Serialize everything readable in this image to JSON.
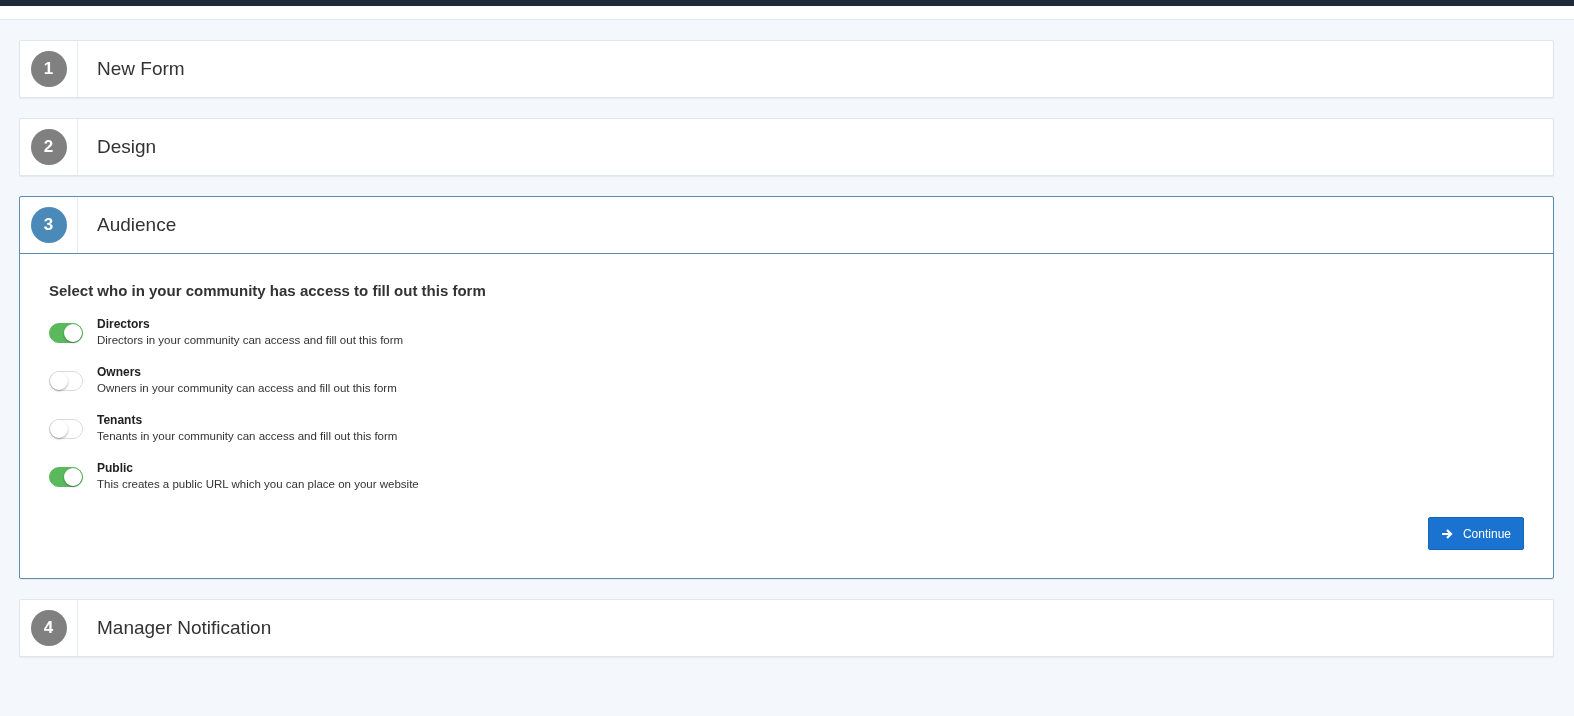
{
  "steps": [
    {
      "number": "1",
      "title": "New Form",
      "expanded": false
    },
    {
      "number": "2",
      "title": "Design",
      "expanded": false
    },
    {
      "number": "3",
      "title": "Audience",
      "expanded": true,
      "body": {
        "heading": "Select who in your community has access to fill out this form",
        "options": [
          {
            "label": "Directors",
            "description": "Directors in your community can access and fill out this form",
            "on": true
          },
          {
            "label": "Owners",
            "description": "Owners in your community can access and fill out this form",
            "on": false
          },
          {
            "label": "Tenants",
            "description": "Tenants in your community can access and fill out this form",
            "on": false
          },
          {
            "label": "Public",
            "description": "This creates a public URL which you can place on your website",
            "on": true
          }
        ],
        "button": "Continue"
      }
    },
    {
      "number": "4",
      "title": "Manager Notification",
      "expanded": false
    }
  ]
}
